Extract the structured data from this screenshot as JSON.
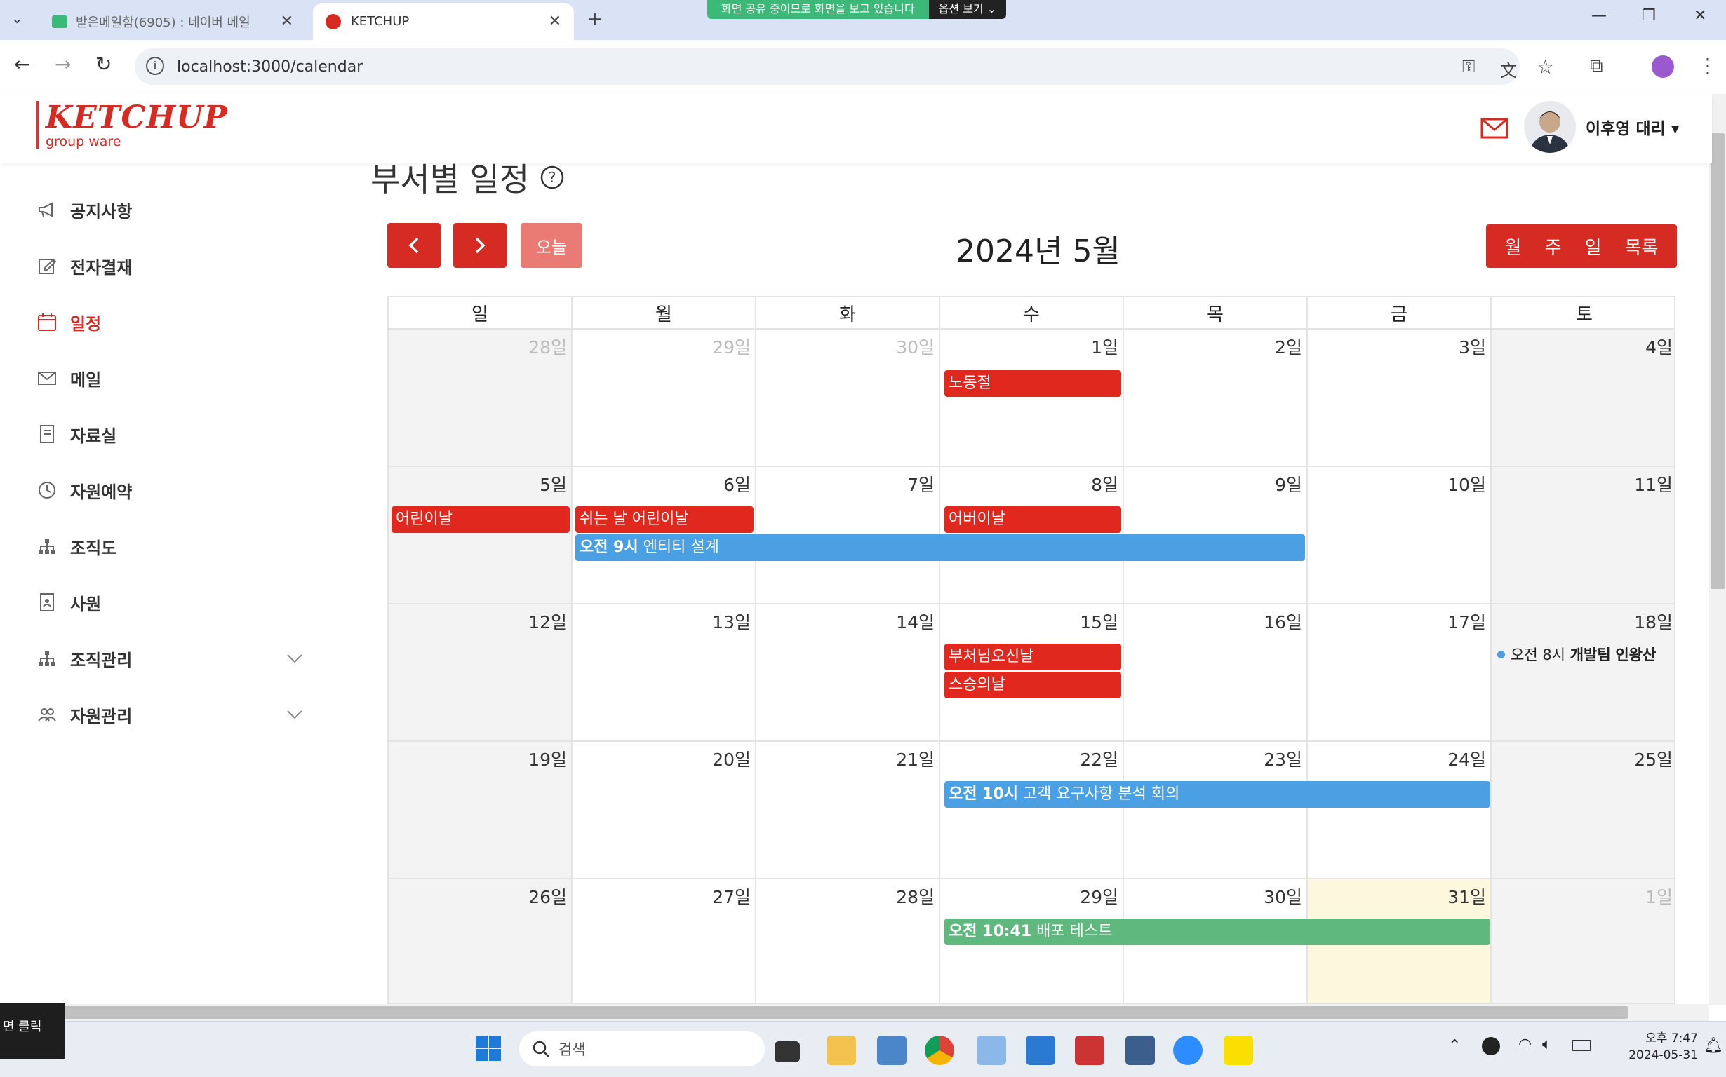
{
  "browser": {
    "tabs": [
      {
        "title": "받은메일함(6905) : 네이버 메일",
        "active": false
      },
      {
        "title": "KETCHUP",
        "active": true
      }
    ],
    "share_banner": "화면 공유 중이므로 화면을 보고 있습니다",
    "share_options": "옵션 보기",
    "url": "localhost:3000/calendar"
  },
  "app": {
    "logo_main": "KETCHUP",
    "logo_sub": "group ware",
    "user_name": "이후영 대리",
    "brand_color": "#d62b22"
  },
  "sidebar": {
    "items": [
      {
        "label": "공지사항",
        "icon": "megaphone-icon"
      },
      {
        "label": "전자결재",
        "icon": "edit-icon"
      },
      {
        "label": "일정",
        "icon": "calendar-icon",
        "active": true
      },
      {
        "label": "메일",
        "icon": "mail-icon"
      },
      {
        "label": "자료실",
        "icon": "document-icon"
      },
      {
        "label": "자원예약",
        "icon": "clock-icon"
      },
      {
        "label": "조직도",
        "icon": "org-chart-icon"
      },
      {
        "label": "사원",
        "icon": "id-card-icon"
      },
      {
        "label": "조직관리",
        "icon": "org-chart-icon",
        "expandable": true
      },
      {
        "label": "자원관리",
        "icon": "users-icon",
        "expandable": true
      }
    ]
  },
  "page": {
    "title": "부서별 일정",
    "today_label": "오늘",
    "calendar_title": "2024년 5월",
    "views": [
      "월",
      "주",
      "일",
      "목록"
    ]
  },
  "calendar": {
    "weekdays": [
      "일",
      "월",
      "화",
      "수",
      "목",
      "금",
      "토"
    ],
    "weeks": [
      [
        "28일",
        "29일",
        "30일",
        "1일",
        "2일",
        "3일",
        "4일"
      ],
      [
        "5일",
        "6일",
        "7일",
        "8일",
        "9일",
        "10일",
        "11일"
      ],
      [
        "12일",
        "13일",
        "14일",
        "15일",
        "16일",
        "17일",
        "18일"
      ],
      [
        "19일",
        "20일",
        "21일",
        "22일",
        "23일",
        "24일",
        "25일"
      ],
      [
        "26일",
        "27일",
        "28일",
        "29일",
        "30일",
        "31일",
        "1일"
      ]
    ],
    "events": {
      "labor_day": "노동절",
      "childrens_day": "어린이날",
      "childrens_day_sub": "쉬는 날 어린이날",
      "parents_day": "어버이날",
      "entity_design_time": "오전 9시",
      "entity_design": "엔티티 설계",
      "buddha_day": "부처님오신날",
      "teachers_day": "스승의날",
      "outing_time": "오전 8시",
      "outing_title_bold": "개발팀",
      "outing_title": "인왕산",
      "meeting_time": "오전 10시",
      "meeting_title": "고객 요구사항 분석 회의",
      "deploy_time": "오전 10:41",
      "deploy_title": "배포 테스트"
    },
    "colors": {
      "holiday": "#e0281f",
      "schedule": "#4aa0e2",
      "deploy": "#5fb87e",
      "today_bg": "#fdf7dd"
    }
  },
  "taskbar": {
    "tooltip": "면 클릭",
    "search_placeholder": "검색",
    "time": "오후 7:47",
    "date": "2024-05-31"
  }
}
